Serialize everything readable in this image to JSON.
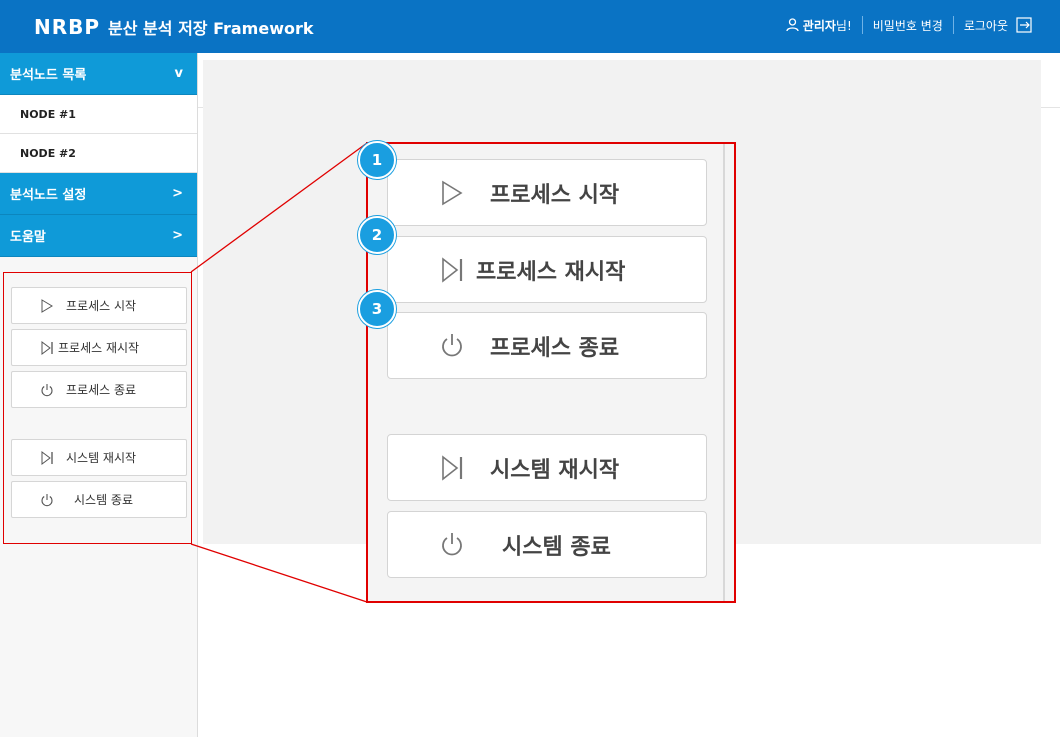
{
  "header": {
    "brand": "NRBP",
    "title": "분산 분석 저장 Framework",
    "user_name": "관리자",
    "user_suffix": "님!",
    "change_password": "비밀번호 변경",
    "logout": "로그아웃"
  },
  "sidebar": {
    "menu_nodes": {
      "label": "분석노드 목록",
      "indicator": "v"
    },
    "nodes": [
      "NODE #1",
      "NODE #2"
    ],
    "menu_settings": {
      "label": "분석노드 설정",
      "indicator": ">"
    },
    "menu_help": {
      "label": "도움말",
      "indicator": ">"
    },
    "buttons": {
      "process_start": "프로세스 시작",
      "process_restart": "프로세스 재시작",
      "process_stop": "프로세스 종료",
      "system_restart": "시스템 재시작",
      "system_stop": "시스템 종료"
    }
  },
  "zoom": {
    "buttons": {
      "process_start": "프로세스 시작",
      "process_restart": "프로세스 재시작",
      "process_stop": "프로세스 종료",
      "system_restart": "시스템 재시작",
      "system_stop": "시스템 종료"
    },
    "callouts": [
      "1",
      "2",
      "3"
    ]
  },
  "colors": {
    "header": "#0a73c4",
    "menu": "#0f9ad8",
    "highlight": "#e00000",
    "callout": "#1a9ee0"
  },
  "icons": [
    "user-icon",
    "logout-icon",
    "play-icon",
    "restart-icon",
    "power-icon"
  ]
}
